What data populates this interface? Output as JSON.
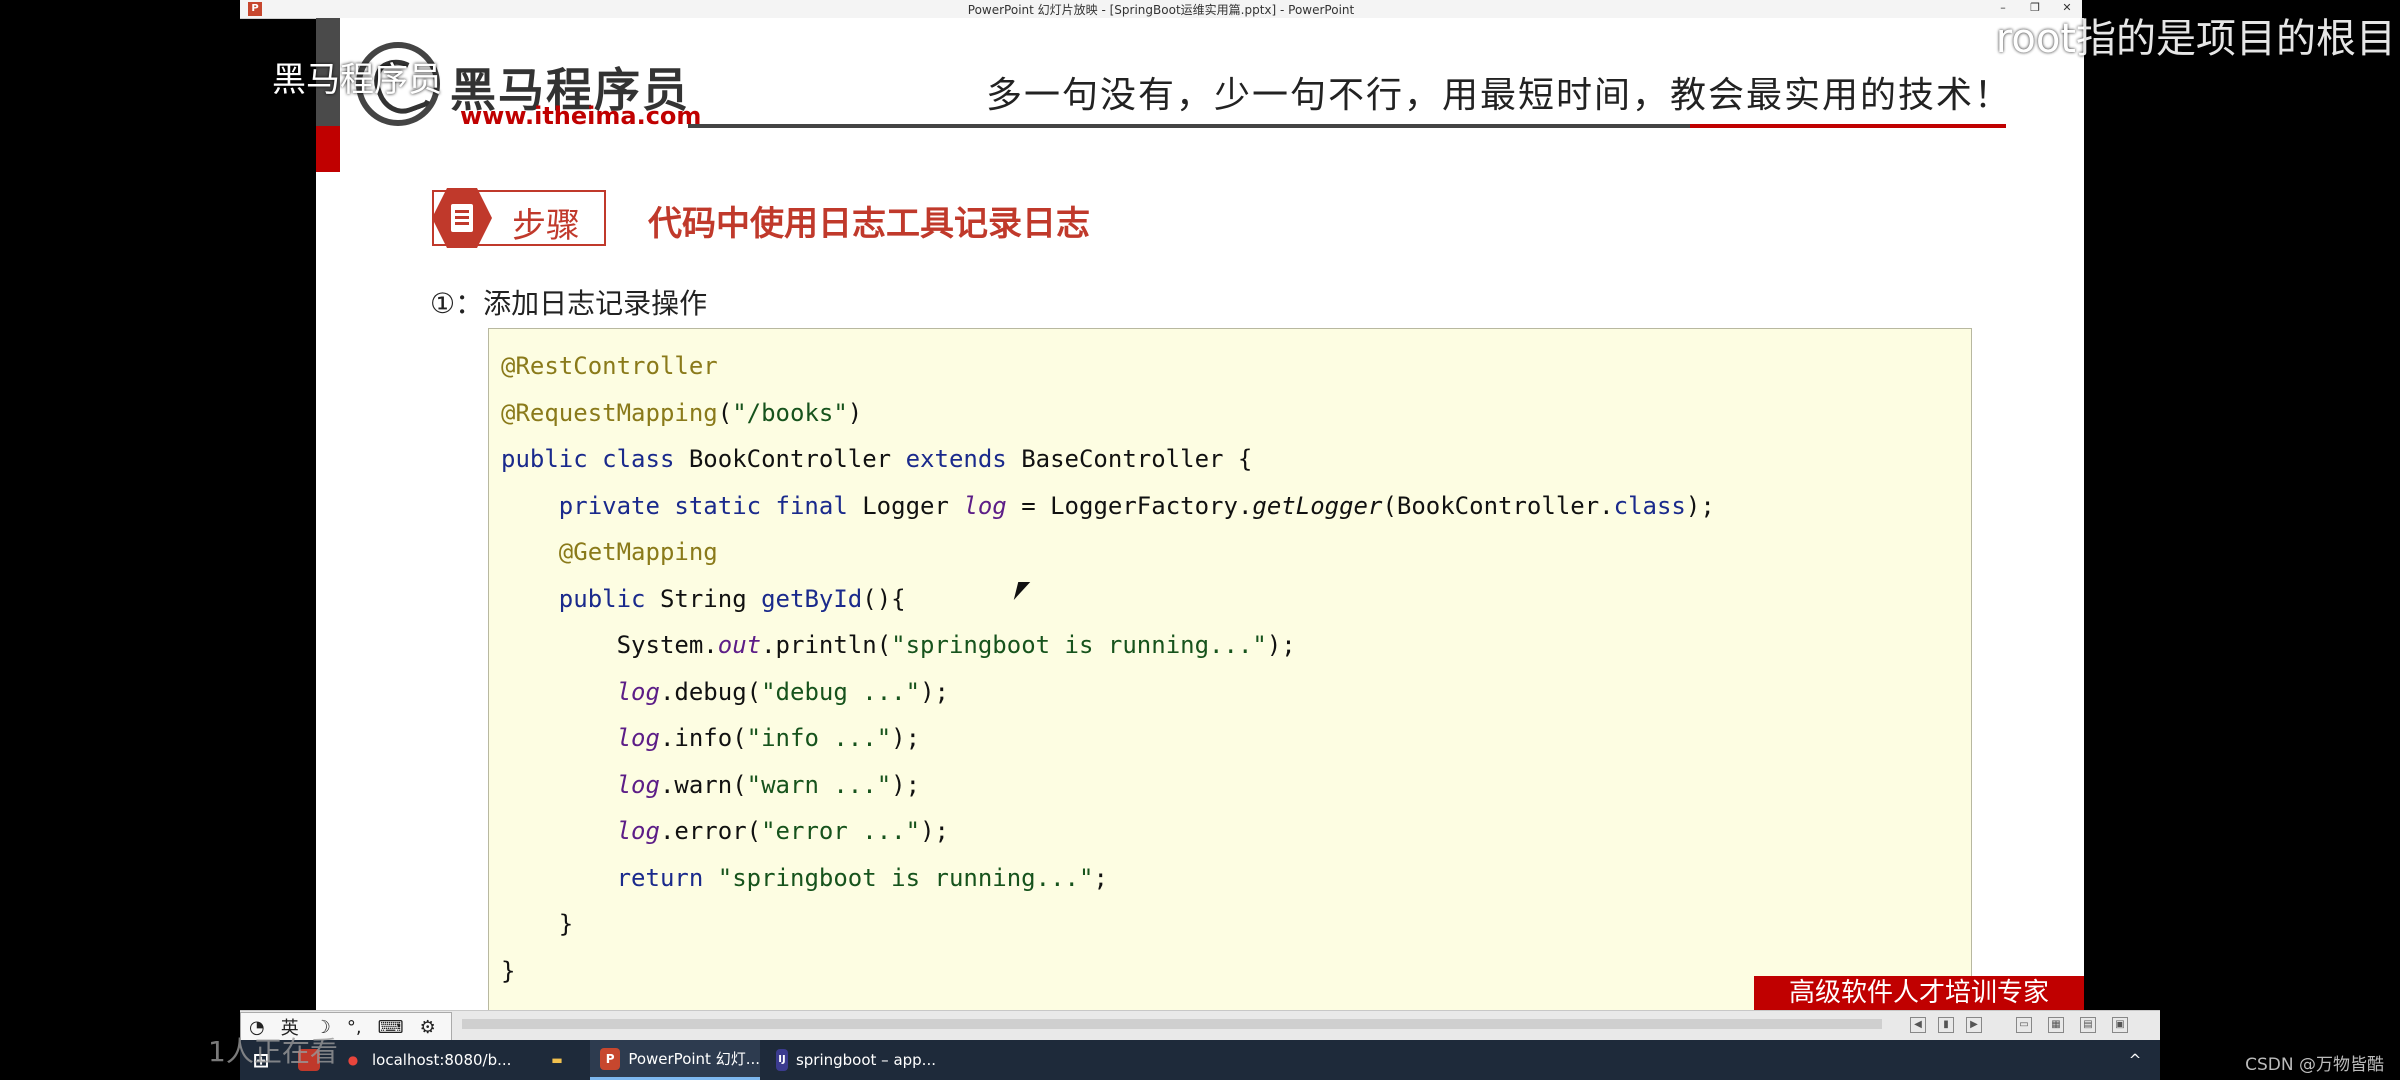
{
  "window": {
    "title": "PowerPoint 幻灯片放映 - [SpringBoot运维实用篇.pptx] - PowerPoint",
    "minimize": "–",
    "restore": "❐",
    "close": "✕"
  },
  "overlays": {
    "top_left": "黑马程序员",
    "top_right": "root指的是项目的根目",
    "bottom_left": "1人正在看",
    "watermark": "CSDN @万物皆酷"
  },
  "slide": {
    "logo_text": "黑马程序员",
    "logo_url": "www.itheima.com",
    "slogan": "多一句没有，少一句不行，用最短时间，教会最实用的技术！",
    "step_label": "步骤",
    "step_title": "代码中使用日志工具记录日志",
    "instruction": "①：添加日志记录操作",
    "footer_banner": "高级软件人才培训专家",
    "code_lines": [
      [
        {
          "c": "ann",
          "t": "@RestController"
        }
      ],
      [
        {
          "c": "ann",
          "t": "@RequestMapping"
        },
        {
          "c": "",
          "t": "("
        },
        {
          "c": "str",
          "t": "\"/books\""
        },
        {
          "c": "",
          "t": ")"
        }
      ],
      [
        {
          "c": "kw",
          "t": "public class "
        },
        {
          "c": "",
          "t": "BookController "
        },
        {
          "c": "kw",
          "t": "extends "
        },
        {
          "c": "",
          "t": "BaseController {"
        }
      ],
      [
        {
          "c": "",
          "t": "    "
        },
        {
          "c": "kw",
          "t": "private static final "
        },
        {
          "c": "",
          "t": "Logger "
        },
        {
          "c": "it",
          "t": "log"
        },
        {
          "c": "",
          "t": " = LoggerFactory."
        },
        {
          "c": "itk",
          "t": "getLogger"
        },
        {
          "c": "",
          "t": "(BookController."
        },
        {
          "c": "kw",
          "t": "class"
        },
        {
          "c": "",
          "t": ");"
        }
      ],
      [
        {
          "c": "",
          "t": "    "
        },
        {
          "c": "ann",
          "t": "@GetMapping"
        }
      ],
      [
        {
          "c": "",
          "t": "    "
        },
        {
          "c": "kw",
          "t": "public "
        },
        {
          "c": "",
          "t": "String "
        },
        {
          "c": "kw",
          "t": "getById"
        },
        {
          "c": "",
          "t": "(){"
        }
      ],
      [
        {
          "c": "",
          "t": "        System."
        },
        {
          "c": "it",
          "t": "out"
        },
        {
          "c": "",
          "t": ".println("
        },
        {
          "c": "str",
          "t": "\"springboot is running...\""
        },
        {
          "c": "",
          "t": ");"
        }
      ],
      [
        {
          "c": "",
          "t": "        "
        },
        {
          "c": "it",
          "t": "log"
        },
        {
          "c": "",
          "t": ".debug("
        },
        {
          "c": "str",
          "t": "\"debug ...\""
        },
        {
          "c": "",
          "t": ");"
        }
      ],
      [
        {
          "c": "",
          "t": "        "
        },
        {
          "c": "it",
          "t": "log"
        },
        {
          "c": "",
          "t": ".info("
        },
        {
          "c": "str",
          "t": "\"info ...\""
        },
        {
          "c": "",
          "t": ");"
        }
      ],
      [
        {
          "c": "",
          "t": "        "
        },
        {
          "c": "it",
          "t": "log"
        },
        {
          "c": "",
          "t": ".warn("
        },
        {
          "c": "str",
          "t": "\"warn ...\""
        },
        {
          "c": "",
          "t": ");"
        }
      ],
      [
        {
          "c": "",
          "t": "        "
        },
        {
          "c": "it",
          "t": "log"
        },
        {
          "c": "",
          "t": ".error("
        },
        {
          "c": "str",
          "t": "\"error ...\""
        },
        {
          "c": "",
          "t": ");"
        }
      ],
      [
        {
          "c": "",
          "t": "        "
        },
        {
          "c": "kw",
          "t": "return "
        },
        {
          "c": "str",
          "t": "\"springboot is running...\""
        },
        {
          "c": "",
          "t": ";"
        }
      ],
      [
        {
          "c": "",
          "t": "    }"
        }
      ],
      [
        {
          "c": "",
          "t": "}"
        }
      ]
    ]
  },
  "ime": {
    "lang": "英",
    "moon": "☽",
    "punct": "°,",
    "keyboard": "⌨",
    "settings": "⚙"
  },
  "taskbar": {
    "items": [
      {
        "name": "chrome",
        "label": "localhost:8080/b...",
        "glyph": "●",
        "color": "#e8453c"
      },
      {
        "name": "explorer",
        "label": "",
        "glyph": "▬",
        "color": "#f2c14e"
      },
      {
        "name": "powerpoint",
        "label": "PowerPoint 幻灯...",
        "glyph": "P",
        "color": "#c7472e"
      },
      {
        "name": "intellij",
        "label": "springboot – app...",
        "glyph": "IJ",
        "color": "#3b3b8f"
      }
    ],
    "tray": "^"
  },
  "colors": {
    "accent_red": "#c00000",
    "step_red": "#c0392b",
    "code_bg": "#fdfde2"
  }
}
